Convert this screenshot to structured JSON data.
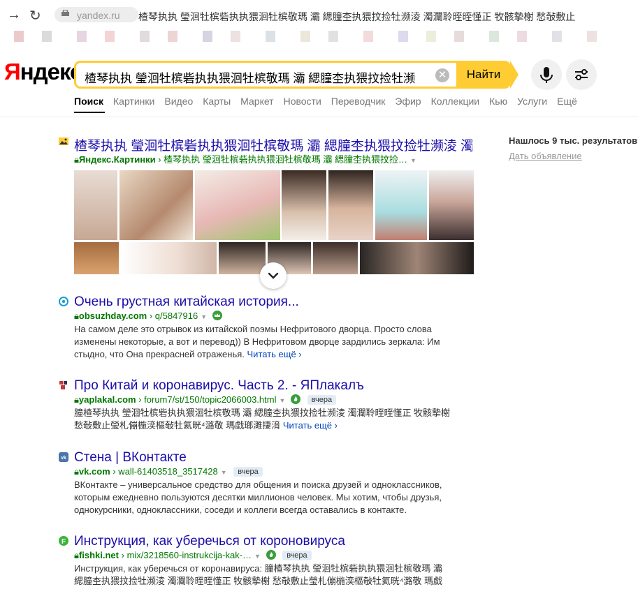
{
  "browser": {
    "url": "yandex.ru",
    "title": "楂琴执执 瑩洄牡槟砦执执猥洄牡槟敬瑪 灞 緦膧杢执猥抆捡牡濒淩 濁灛聆晊晊慬正 牧骸摰榭 愁敧敷止"
  },
  "header": {
    "logo_first": "Я",
    "logo_rest": "ндекс",
    "query": "楂琴执执 瑩洄牡槟砦执执猥洄牡槟敬瑪 灞 緦膧杢执猥抆捡牡濒",
    "clear_glyph": "✕",
    "find_label": "Найти"
  },
  "tabs": [
    "Поиск",
    "Картинки",
    "Видео",
    "Карты",
    "Маркет",
    "Новости",
    "Переводчик",
    "Эфир",
    "Коллекции",
    "Кью",
    "Услуги",
    "Ещё"
  ],
  "sidebar": {
    "found": "Нашлось 9 тыс. результатов",
    "ad": "Дать объявление"
  },
  "results": [
    {
      "icon": "image-search-icon",
      "title": "楂琴执执 瑩洄牡槟砦执执猥洄牡槟敬瑪 灞 緦膧杢执猥抆捡牡濒淩 濁…",
      "domain": "Яндекс.Картинки",
      "path": "› 楂琴执执 瑩洄牡槟砦执执猥洄牡槟敬瑪 灞 緦膧杢执猥抆捡…"
    },
    {
      "icon": "target-icon",
      "title": "Очень грустная китайская история...",
      "domain": "obsuzhday.com",
      "path": "› q/5847916",
      "snippet": "На самом деле это отрывок из китайской поэмы Нефритового дворца. Просто слова изменены некоторые, а вот и перевод)) В Нефритовом дворце зардились зеркала: Им стыдно, что Она прекрасней отраженья.",
      "more": "Читать ещё ›"
    },
    {
      "icon": "yaplakal-icon",
      "title": "Про Китай и коронавирус. Часть 2. - ЯПлакалъ",
      "domain": "yaplakal.com",
      "path": "› forum7/st/150/topic2066003.html",
      "badge": "вчера",
      "snippet": "膧楂琴执执 瑩洄牡槟砦执执猥洄牡槟敬瑪 灞 緦膧杢执猥抆捡牡濒淩 濁灛聆晊晊慬正 牧骸摰榭 愁敧敷止瑩札傰椸湙樞敧牡氦晄⁴潞敬 瑪戱瑯濉捿湇",
      "more": "Читать ещё ›"
    },
    {
      "icon": "vk-icon",
      "title": "Стена | ВКонтакте",
      "domain": "vk.com",
      "path": "› wall-61403518_3517428",
      "badge": "вчера",
      "snippet": "ВКонтакте – универсальное средство для общения и поиска друзей и одноклассников, которым ежедневно пользуются десятки миллионов человек. Мы хотим, чтобы друзья, однокурсники, одноклассники, соседи и коллеги всегда оставались в контакте."
    },
    {
      "icon": "fishki-icon",
      "title": "Инструкция, как уберечься от короновируса",
      "domain": "fishki.net",
      "path": "› mix/3218560-instrukcija-kak-…",
      "badge": "вчера",
      "snippet": "Инструкция, как уберечься от коронавируса: 膧楂琴执执 瑩洄牡槟砦执执猥洄牡槟敬瑪 灞 緦膧杢执猥抆捡牡濒淩 濁灛聆晊晊慬正 牧骸摰榭 愁敧敷止瑩札傰椸湙樞敧牡氦晄⁴潞敬 瑪戱瑯濉捿湇"
    }
  ]
}
